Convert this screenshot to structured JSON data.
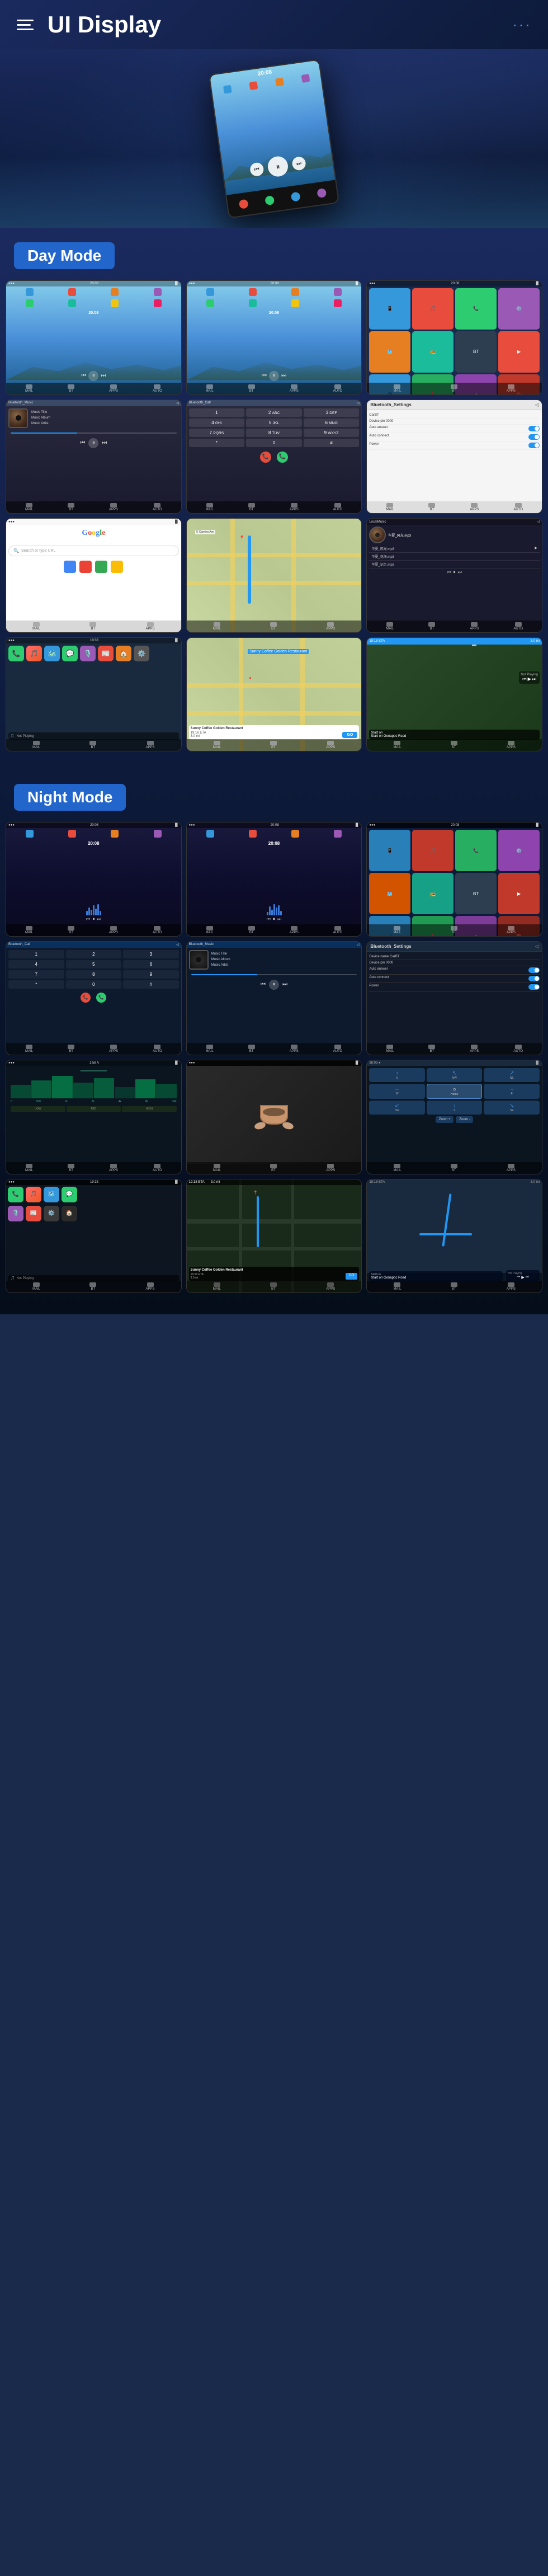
{
  "header": {
    "title": "UI Display",
    "menu_icon": "☰",
    "dots_icon": "···"
  },
  "sections": {
    "day_mode": {
      "label": "Day Mode",
      "screens": [
        {
          "id": "home1",
          "type": "home",
          "time": "20:08"
        },
        {
          "id": "home2",
          "type": "home",
          "time": "20:08"
        },
        {
          "id": "apps1",
          "type": "apps"
        },
        {
          "id": "music1",
          "type": "music"
        },
        {
          "id": "phone1",
          "type": "phone"
        },
        {
          "id": "bluetooth1",
          "type": "bluetooth"
        },
        {
          "id": "google1",
          "type": "google"
        },
        {
          "id": "map1",
          "type": "map"
        },
        {
          "id": "local1",
          "type": "local"
        },
        {
          "id": "carplay1",
          "type": "carplay"
        },
        {
          "id": "navi1",
          "type": "navi"
        },
        {
          "id": "navi2",
          "type": "navi2"
        }
      ]
    },
    "night_mode": {
      "label": "Night Mode",
      "screens": [
        {
          "id": "n_home1",
          "type": "home_night",
          "time": "20:08"
        },
        {
          "id": "n_home2",
          "type": "home_night",
          "time": "20:08"
        },
        {
          "id": "n_apps1",
          "type": "apps_night"
        },
        {
          "id": "n_phone1",
          "type": "phone_night"
        },
        {
          "id": "n_music1",
          "type": "music_night"
        },
        {
          "id": "n_bluetooth1",
          "type": "bluetooth_night"
        },
        {
          "id": "n_video1",
          "type": "video"
        },
        {
          "id": "n_photo1",
          "type": "photo"
        },
        {
          "id": "n_navi1",
          "type": "navi_night"
        },
        {
          "id": "n_carplay1",
          "type": "carplay_night"
        },
        {
          "id": "n_navi2",
          "type": "navi2_night"
        },
        {
          "id": "n_extra1",
          "type": "extra"
        }
      ]
    }
  },
  "music": {
    "title": "Music Title",
    "album": "Music Album",
    "artist": "Music Artist"
  },
  "bluetooth": {
    "device_name": "CarBT",
    "device_pin": "0000",
    "auto_answer": "Auto answer",
    "auto_connect": "Auto connect",
    "power": "Power"
  },
  "nav": {
    "coffee_shop": "Sunny Coffee Golden Restaurant",
    "eta": "19:16 ETA",
    "distance": "3.0 mi",
    "direction": "Start on Gonapoc Road",
    "go_label": "GO",
    "not_playing": "Not Playing"
  },
  "icons": {
    "menu": "☰",
    "dots": "⋯",
    "play": "▶",
    "pause": "⏸",
    "prev": "⏮",
    "next": "⏭",
    "skip_back": "⏪",
    "skip_fwd": "⏩",
    "phone": "📞",
    "music_note": "♪",
    "map_pin": "📍",
    "search": "🔍",
    "bluetooth": "⚡",
    "wifi": "📶",
    "back": "←",
    "close": "✕"
  }
}
